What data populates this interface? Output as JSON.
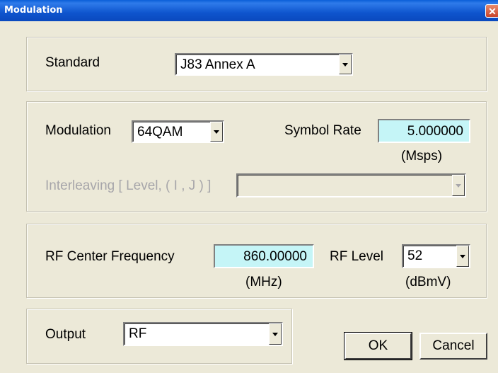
{
  "window": {
    "title": "Modulation",
    "close_glyph": "✕"
  },
  "standard": {
    "label": "Standard",
    "value": "J83 Annex A"
  },
  "modulation": {
    "label": "Modulation",
    "value": "64QAM",
    "symbol_rate_label": "Symbol Rate",
    "symbol_rate_value": "5.000000",
    "symbol_rate_unit": "(Msps)",
    "interleaving_label": "Interleaving [ Level, ( I , J ) ]",
    "interleaving_value": ""
  },
  "rf": {
    "freq_label": "RF Center Frequency",
    "freq_value": "860.00000",
    "freq_unit": "(MHz)",
    "level_label": "RF Level",
    "level_value": "52",
    "level_unit": "(dBmV)"
  },
  "output": {
    "label": "Output",
    "value": "RF"
  },
  "buttons": {
    "ok": "OK",
    "cancel": "Cancel"
  },
  "colors": {
    "title_bar": "#0A49BE",
    "field_bg": "#C5F5F7",
    "dialog_bg": "#ECE9D8"
  }
}
